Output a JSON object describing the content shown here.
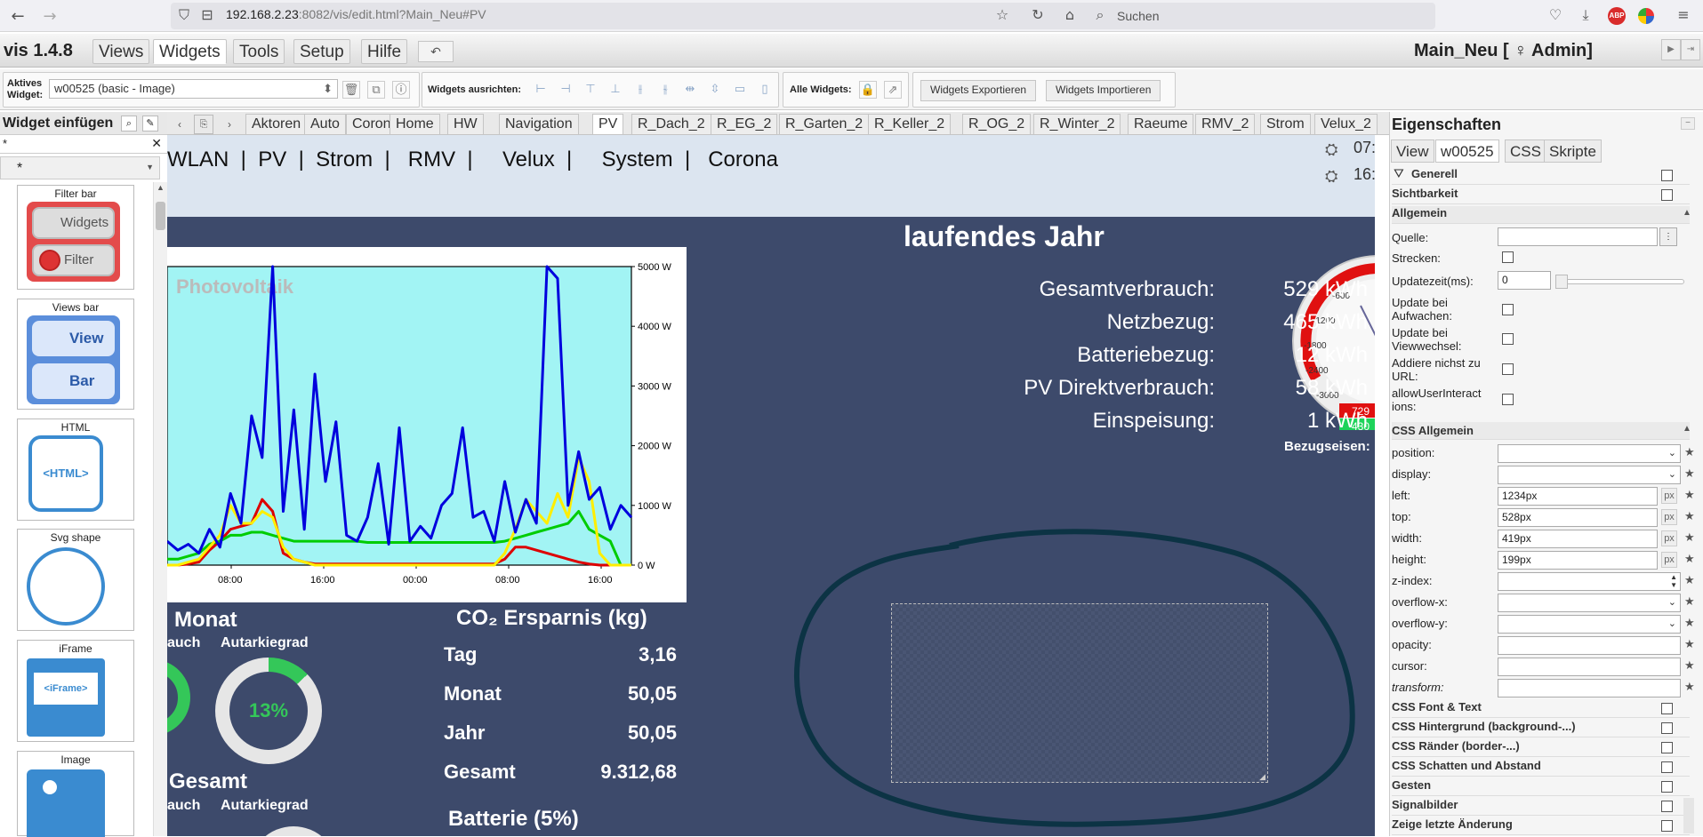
{
  "browser": {
    "url_host": "192.168.2.23",
    "url_rest": ":8082/vis/edit.html?Main_Neu#PV",
    "search_placeholder": "Suchen"
  },
  "app": {
    "title": "vis 1.4.8",
    "menu": [
      "Views",
      "Widgets",
      "Tools",
      "Setup",
      "Hilfe"
    ],
    "active_menu": "Widgets",
    "project_title": "Main_Neu [ ♀ Admin]"
  },
  "toolbar": {
    "active_widget_label_1": "Aktives",
    "active_widget_label_2": "Widget:",
    "active_widget_value": "w00525 (basic - Image)",
    "align_label": "Widgets ausrichten:",
    "all_widgets_label": "Alle Widgets:",
    "export_label": "Widgets Exportieren",
    "import_label": "Widgets Importieren"
  },
  "palette": {
    "title": "Widget einfügen",
    "filter_value": "*",
    "select_value": "*",
    "cards": [
      {
        "title": "Filter bar",
        "btn1": "Widgets",
        "btn2": "Filter"
      },
      {
        "title": "Views bar",
        "btn1": "View",
        "btn2": "Bar"
      },
      {
        "title": "HTML",
        "inner": "<HTML>"
      },
      {
        "title": "Svg shape"
      },
      {
        "title": "iFrame",
        "inner": "<iFrame>"
      },
      {
        "title": "Image"
      }
    ]
  },
  "view_tabs": [
    "Aktoren",
    "Auto",
    "Corona",
    "Home",
    "HW",
    "Navigation",
    "PV",
    "R_Dach_2",
    "R_EG_2",
    "R_Garten_2",
    "R_Keller_2",
    "R_OG_2",
    "R_Winter_2",
    "Raeume",
    "RMV_2",
    "Strom",
    "Velux_2"
  ],
  "active_view": "PV",
  "canvas": {
    "top_nav": "WLAN  |  PV  |  Strom  |   RMV  |     Velux  |     System  |   Corona",
    "time1": "07:",
    "time2": "16:",
    "stats_title": "laufendes Jahr",
    "stats": [
      {
        "label": "Gesamtverbrauch:",
        "value": "529 kWh"
      },
      {
        "label": "Netzbezug:",
        "value": "465 kWh"
      },
      {
        "label": "Batteriebezug:",
        "value": "12 kWh"
      },
      {
        "label": "PV Direktverbrauch:",
        "value": "58 kWh"
      },
      {
        "label": "Einspeisung:",
        "value": "1 kWh"
      }
    ],
    "gauge_ticks": [
      "-600",
      "-1200",
      "-1800",
      "-2400",
      "-3000"
    ],
    "gauge_value1": "729",
    "gauge_value2": "430",
    "gauge_label": "Bezugseisen:",
    "monat_title": "Monat",
    "gesamt_title": "Gesamt",
    "monat_sub1": "auch",
    "monat_sub2": "Autarkiegrad",
    "gesamt_sub1": "auch",
    "gesamt_sub2": "Autarkiegrad",
    "autarkie_value": "13%",
    "co2_title": "CO₂ Ersparnis (kg)",
    "co2": [
      {
        "label": "Tag",
        "value": "3,16"
      },
      {
        "label": "Monat",
        "value": "50,05"
      },
      {
        "label": "Jahr",
        "value": "50,05"
      },
      {
        "label": "Gesamt",
        "value": "9.312,68"
      }
    ],
    "battery_title": "Batterie (5%)"
  },
  "chart_data": {
    "type": "line",
    "title": "Photovoltaik",
    "x": [
      "08:00",
      "16:00",
      "00:00",
      "08:00",
      "16:00"
    ],
    "ylim": [
      0,
      5000
    ],
    "yticks": [
      "5000 W",
      "4000 W",
      "3000 W",
      "2000 W",
      "1000 W",
      "0 W"
    ],
    "series": [
      {
        "color": "#0000dd",
        "values": [
          400,
          250,
          350,
          200,
          600,
          300,
          1200,
          700,
          2500,
          1800,
          5000,
          900,
          2600,
          600,
          3200,
          1400,
          2400,
          500,
          400,
          800,
          1700,
          350,
          2300,
          400,
          650,
          450,
          1000,
          1200,
          2300,
          800,
          900,
          400,
          1400,
          550,
          1100,
          700,
          5000,
          4800,
          1000,
          1900,
          1100,
          1300,
          600,
          1000,
          800
        ]
      },
      {
        "color": "#ffee00",
        "values": [
          0,
          0,
          50,
          100,
          300,
          500,
          1000,
          700,
          700,
          900,
          800,
          300,
          100,
          50,
          0,
          0,
          0,
          0,
          0,
          0,
          0,
          0,
          0,
          0,
          0,
          0,
          0,
          0,
          0,
          0,
          0,
          0,
          200,
          600,
          1100,
          900,
          700,
          1200,
          800,
          1800,
          1400,
          200,
          0,
          0,
          0
        ]
      },
      {
        "color": "#00cc00",
        "values": [
          100,
          100,
          150,
          200,
          350,
          400,
          500,
          500,
          550,
          550,
          500,
          450,
          400,
          400,
          400,
          400,
          400,
          400,
          400,
          380,
          380,
          380,
          380,
          380,
          380,
          380,
          380,
          380,
          380,
          380,
          380,
          380,
          400,
          450,
          500,
          550,
          600,
          650,
          700,
          900,
          600,
          500,
          400,
          0,
          0
        ]
      },
      {
        "color": "#dd0000",
        "values": [
          0,
          0,
          20,
          50,
          250,
          400,
          600,
          650,
          700,
          1100,
          900,
          200,
          100,
          50,
          20,
          20,
          20,
          20,
          20,
          20,
          20,
          20,
          20,
          20,
          20,
          20,
          20,
          20,
          20,
          20,
          20,
          20,
          100,
          300,
          300,
          250,
          200,
          150,
          100,
          50,
          20,
          0,
          0,
          0,
          0
        ]
      }
    ]
  },
  "properties": {
    "title": "Eigenschaften",
    "tabs": [
      "View",
      "w00525",
      "CSS",
      "Skripte"
    ],
    "active_tab": "w00525",
    "generell": "Generell",
    "sichtbarkeit": "Sichtbarkeit",
    "allgemein": "Allgemein",
    "quelle": "Quelle:",
    "strecken": "Strecken:",
    "updatezeit": "Updatezeit(ms):",
    "updatezeit_value": "0",
    "update_aufwachen_1": "Update bei",
    "update_aufwachen_2": "Aufwachen:",
    "update_view_1": "Update bei",
    "update_view_2": "Viewwechsel:",
    "addiere_1": "Addiere nichst zu",
    "addiere_2": "URL:",
    "allow_1": "allowUserInteract",
    "allow_2": "ions:",
    "css_allgemein": "CSS Allgemein",
    "css_fields": [
      {
        "label": "position:",
        "kind": "select",
        "value": ""
      },
      {
        "label": "display:",
        "kind": "select",
        "value": ""
      },
      {
        "label": "left:",
        "kind": "px",
        "value": "1234px"
      },
      {
        "label": "top:",
        "kind": "px",
        "value": "528px"
      },
      {
        "label": "width:",
        "kind": "px",
        "value": "419px"
      },
      {
        "label": "height:",
        "kind": "px",
        "value": "199px"
      },
      {
        "label": "z-index:",
        "kind": "spin",
        "value": ""
      },
      {
        "label": "overflow-x:",
        "kind": "select",
        "value": ""
      },
      {
        "label": "overflow-y:",
        "kind": "select",
        "value": ""
      },
      {
        "label": "opacity:",
        "kind": "text",
        "value": ""
      },
      {
        "label": "cursor:",
        "kind": "text",
        "value": ""
      },
      {
        "label": "transform:",
        "kind": "text",
        "value": ""
      }
    ],
    "sections": [
      "CSS Font & Text",
      "CSS Hintergrund (background-...)",
      "CSS Ränder (border-...)",
      "CSS Schatten und Abstand",
      "Gesten",
      "Signalbilder",
      "Zeige letzte Änderung"
    ]
  }
}
